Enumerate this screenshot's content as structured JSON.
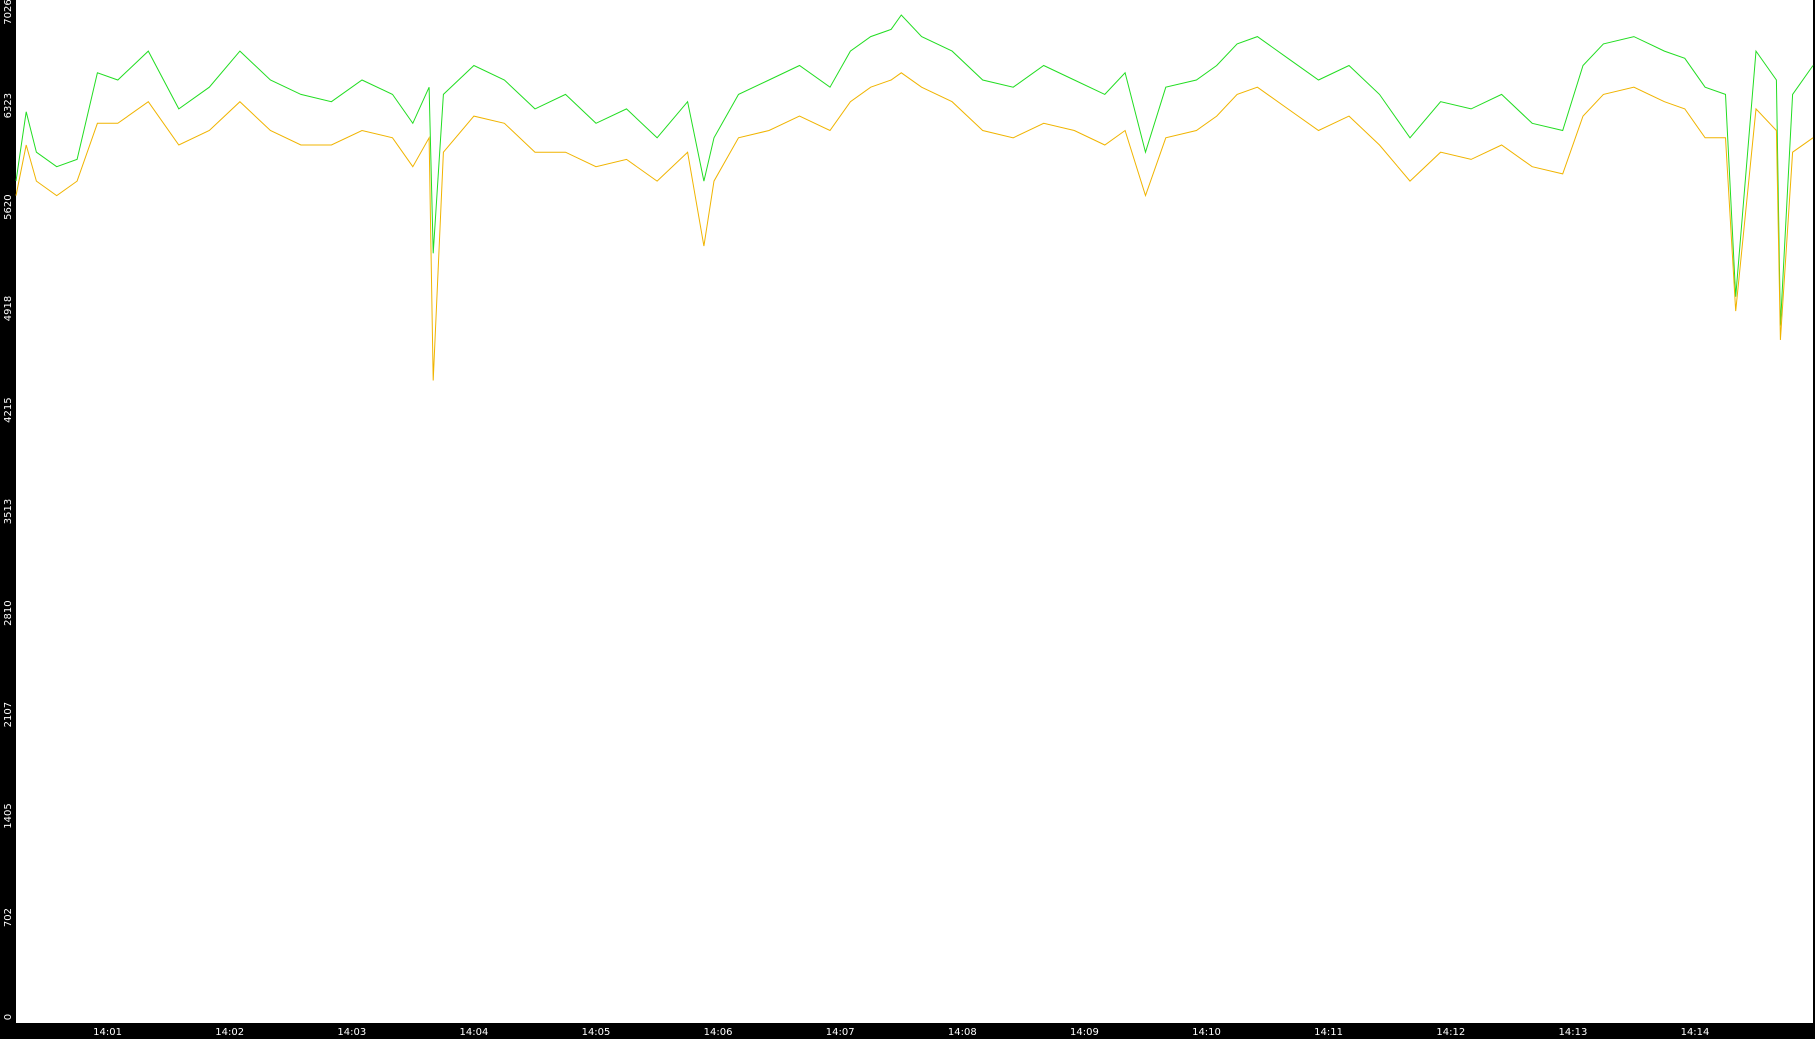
{
  "chart_data": {
    "type": "line",
    "title": "",
    "xlabel": "",
    "ylabel": "",
    "grid": false,
    "legend": "none",
    "ylim": [
      0,
      7026
    ],
    "xlim": [
      "14:00:15",
      "14:14:58"
    ],
    "y_ticks": [
      "0",
      "702",
      "1405",
      "2107",
      "2810",
      "3513",
      "4215",
      "4918",
      "5620",
      "6323",
      "7026"
    ],
    "x_ticks": [
      "14:01",
      "14:02",
      "14:03",
      "14:04",
      "14:05",
      "14:06",
      "14:07",
      "14:08",
      "14:09",
      "14:10",
      "14:11",
      "14:12",
      "14:13",
      "14:14"
    ],
    "colors": {
      "background": "#ffffff",
      "axis_band": "#000000",
      "tick_text": "#ffffff"
    },
    "series": [
      {
        "color": "#22dd22",
        "x": [
          "14:00:15",
          "14:00:20",
          "14:00:25",
          "14:00:35",
          "14:00:45",
          "14:00:55",
          "14:01:05",
          "14:01:20",
          "14:01:35",
          "14:01:50",
          "14:02:05",
          "14:02:20",
          "14:02:35",
          "14:02:50",
          "14:03:05",
          "14:03:20",
          "14:03:30",
          "14:03:38",
          "14:03:40",
          "14:03:45",
          "14:04:00",
          "14:04:15",
          "14:04:30",
          "14:04:45",
          "14:05:00",
          "14:05:15",
          "14:05:30",
          "14:05:45",
          "14:05:53",
          "14:05:58",
          "14:06:10",
          "14:06:25",
          "14:06:40",
          "14:06:55",
          "14:07:05",
          "14:07:15",
          "14:07:25",
          "14:07:30",
          "14:07:40",
          "14:07:55",
          "14:08:10",
          "14:08:25",
          "14:08:40",
          "14:08:55",
          "14:09:10",
          "14:09:20",
          "14:09:30",
          "14:09:40",
          "14:09:55",
          "14:10:05",
          "14:10:15",
          "14:10:25",
          "14:10:40",
          "14:10:55",
          "14:11:10",
          "14:11:25",
          "14:11:40",
          "14:11:55",
          "14:12:10",
          "14:12:25",
          "14:12:40",
          "14:12:55",
          "14:13:05",
          "14:13:15",
          "14:13:30",
          "14:13:45",
          "14:13:55",
          "14:14:05",
          "14:14:15",
          "14:14:20",
          "14:14:30",
          "14:14:40",
          "14:14:42",
          "14:14:48",
          "14:14:58"
        ],
        "y": [
          5800,
          6280,
          6000,
          5900,
          5950,
          6550,
          6500,
          6700,
          6300,
          6450,
          6700,
          6500,
          6400,
          6350,
          6500,
          6400,
          6200,
          6450,
          5300,
          6400,
          6600,
          6500,
          6300,
          6400,
          6200,
          6300,
          6100,
          6350,
          5800,
          6100,
          6400,
          6500,
          6600,
          6450,
          6700,
          6800,
          6850,
          6950,
          6800,
          6700,
          6500,
          6450,
          6600,
          6500,
          6400,
          6550,
          6000,
          6450,
          6500,
          6600,
          6750,
          6800,
          6650,
          6500,
          6600,
          6400,
          6100,
          6350,
          6300,
          6400,
          6200,
          6150,
          6600,
          6750,
          6800,
          6700,
          6650,
          6450,
          6400,
          5000,
          6700,
          6500,
          4800,
          6400,
          6600
        ]
      },
      {
        "color": "#f0b400",
        "x": [
          "14:00:15",
          "14:00:20",
          "14:00:25",
          "14:00:35",
          "14:00:45",
          "14:00:55",
          "14:01:05",
          "14:01:20",
          "14:01:35",
          "14:01:50",
          "14:02:05",
          "14:02:20",
          "14:02:35",
          "14:02:50",
          "14:03:05",
          "14:03:20",
          "14:03:30",
          "14:03:38",
          "14:03:40",
          "14:03:45",
          "14:04:00",
          "14:04:15",
          "14:04:30",
          "14:04:45",
          "14:05:00",
          "14:05:15",
          "14:05:30",
          "14:05:45",
          "14:05:53",
          "14:05:58",
          "14:06:10",
          "14:06:25",
          "14:06:40",
          "14:06:55",
          "14:07:05",
          "14:07:15",
          "14:07:25",
          "14:07:30",
          "14:07:40",
          "14:07:55",
          "14:08:10",
          "14:08:25",
          "14:08:40",
          "14:08:55",
          "14:09:10",
          "14:09:20",
          "14:09:30",
          "14:09:40",
          "14:09:55",
          "14:10:05",
          "14:10:15",
          "14:10:25",
          "14:10:40",
          "14:10:55",
          "14:11:10",
          "14:11:25",
          "14:11:40",
          "14:11:55",
          "14:12:10",
          "14:12:25",
          "14:12:40",
          "14:12:55",
          "14:13:05",
          "14:13:15",
          "14:13:30",
          "14:13:45",
          "14:13:55",
          "14:14:05",
          "14:14:15",
          "14:14:20",
          "14:14:30",
          "14:14:40",
          "14:14:42",
          "14:14:48",
          "14:14:58"
        ],
        "y": [
          5700,
          6050,
          5800,
          5700,
          5800,
          6200,
          6200,
          6350,
          6050,
          6150,
          6350,
          6150,
          6050,
          6050,
          6150,
          6100,
          5900,
          6100,
          4420,
          6000,
          6250,
          6200,
          6000,
          6000,
          5900,
          5950,
          5800,
          6000,
          5350,
          5800,
          6100,
          6150,
          6250,
          6150,
          6350,
          6450,
          6500,
          6550,
          6450,
          6350,
          6150,
          6100,
          6200,
          6150,
          6050,
          6150,
          5700,
          6100,
          6150,
          6250,
          6400,
          6450,
          6300,
          6150,
          6250,
          6050,
          5800,
          6000,
          5950,
          6050,
          5900,
          5850,
          6250,
          6400,
          6450,
          6350,
          6300,
          6100,
          6100,
          4900,
          6300,
          6150,
          4700,
          6000,
          6100
        ]
      }
    ]
  }
}
